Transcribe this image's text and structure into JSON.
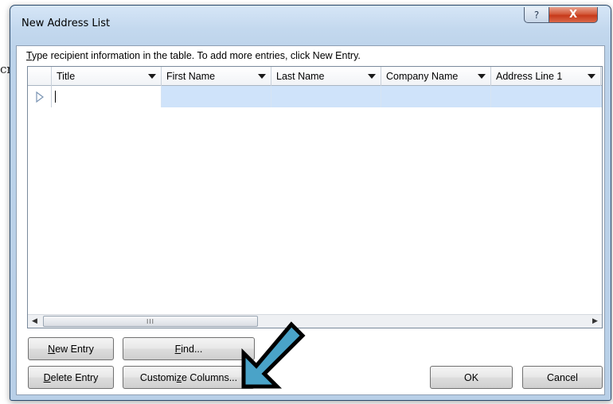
{
  "background": {
    "fragment": "cr"
  },
  "window": {
    "title": "New Address List",
    "help_glyph": "?",
    "close_glyph": "X"
  },
  "instruction": {
    "mnemonic": "T",
    "rest": "ype recipient information in the table.  To add more entries, click New Entry."
  },
  "grid": {
    "columns": [
      "Title",
      "First Name",
      "Last Name",
      "Company Name",
      "Address Line 1"
    ],
    "rows": [
      {
        "marker": "current-row",
        "cells": [
          "",
          "",
          "",
          "",
          ""
        ]
      }
    ],
    "scroll_grip": "III"
  },
  "buttons": {
    "new_entry": {
      "mn": "N",
      "rest": "ew Entry"
    },
    "find": {
      "mn": "F",
      "rest": "ind..."
    },
    "delete_entry": {
      "mn": "D",
      "rest": "elete Entry"
    },
    "customize_columns": {
      "pre": "Customi",
      "mn": "z",
      "rest": "e Columns..."
    },
    "ok": "OK",
    "cancel": "Cancel"
  },
  "annotation": {
    "icon": "pointer-arrow-icon",
    "color": "#4aa3c8"
  },
  "colors": {
    "title_bar": "#c3d8ee",
    "selected_row": "#cfe3fa",
    "close_button": "#c7391a"
  }
}
